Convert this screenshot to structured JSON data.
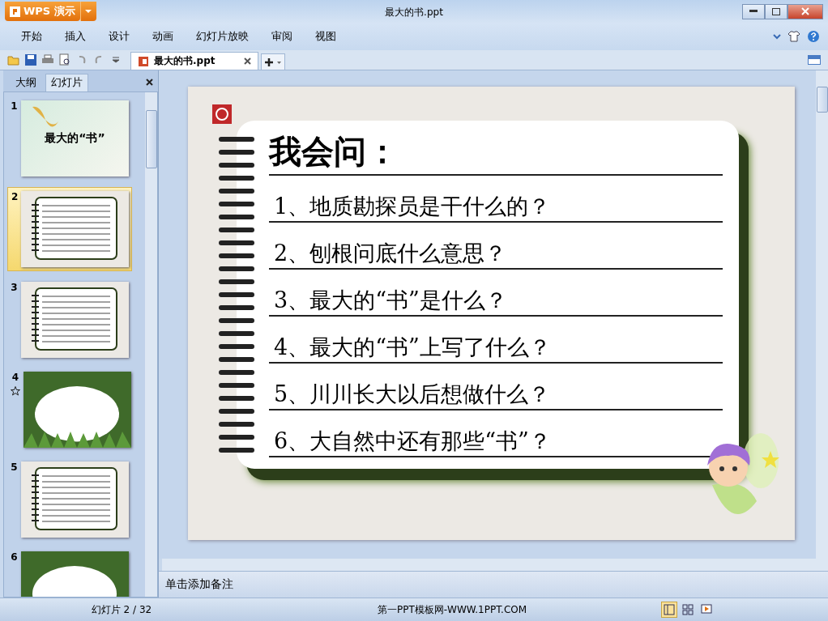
{
  "app_button": {
    "label": "WPS 演示"
  },
  "window": {
    "title": "最大的书.ppt"
  },
  "menu": [
    {
      "label": "开始"
    },
    {
      "label": "插入"
    },
    {
      "label": "设计"
    },
    {
      "label": "动画"
    },
    {
      "label": "幻灯片放映"
    },
    {
      "label": "审阅"
    },
    {
      "label": "视图"
    }
  ],
  "document_tabs": [
    {
      "label": "最大的书.ppt",
      "selected": true
    }
  ],
  "panel_tabs": [
    {
      "label": "大纲",
      "selected": false
    },
    {
      "label": "幻灯片",
      "selected": true
    }
  ],
  "thumbnails": [
    {
      "number": "1",
      "kind": "title",
      "title": "最大的“书”",
      "selected": false,
      "animated": false
    },
    {
      "number": "2",
      "kind": "notebook",
      "selected": true,
      "animated": false
    },
    {
      "number": "3",
      "kind": "notebook",
      "selected": false,
      "animated": false
    },
    {
      "number": "4",
      "kind": "forest",
      "selected": false,
      "animated": true
    },
    {
      "number": "5",
      "kind": "notebook",
      "selected": false,
      "animated": false
    },
    {
      "number": "6",
      "kind": "forest",
      "selected": false,
      "animated": false
    }
  ],
  "slide": {
    "title": "我会问：",
    "questions": [
      "1、地质勘探员是干什么的？",
      "2、刨根问底什么意思？",
      "3、最大的“书”是什么？",
      "4、最大的“书”上写了什么？",
      "5、川川长大以后想做什么？",
      "6、大自然中还有那些“书”？"
    ]
  },
  "notes": {
    "placeholder": "单击添加备注"
  },
  "status_bar": {
    "slide_counter": "幻灯片 2 / 32",
    "template": "第一PPT模板网-WWW.1PPT.COM"
  },
  "view_buttons": [
    {
      "kind": "normal",
      "selected": true
    },
    {
      "kind": "sorter",
      "selected": false
    },
    {
      "kind": "show",
      "selected": false
    }
  ]
}
